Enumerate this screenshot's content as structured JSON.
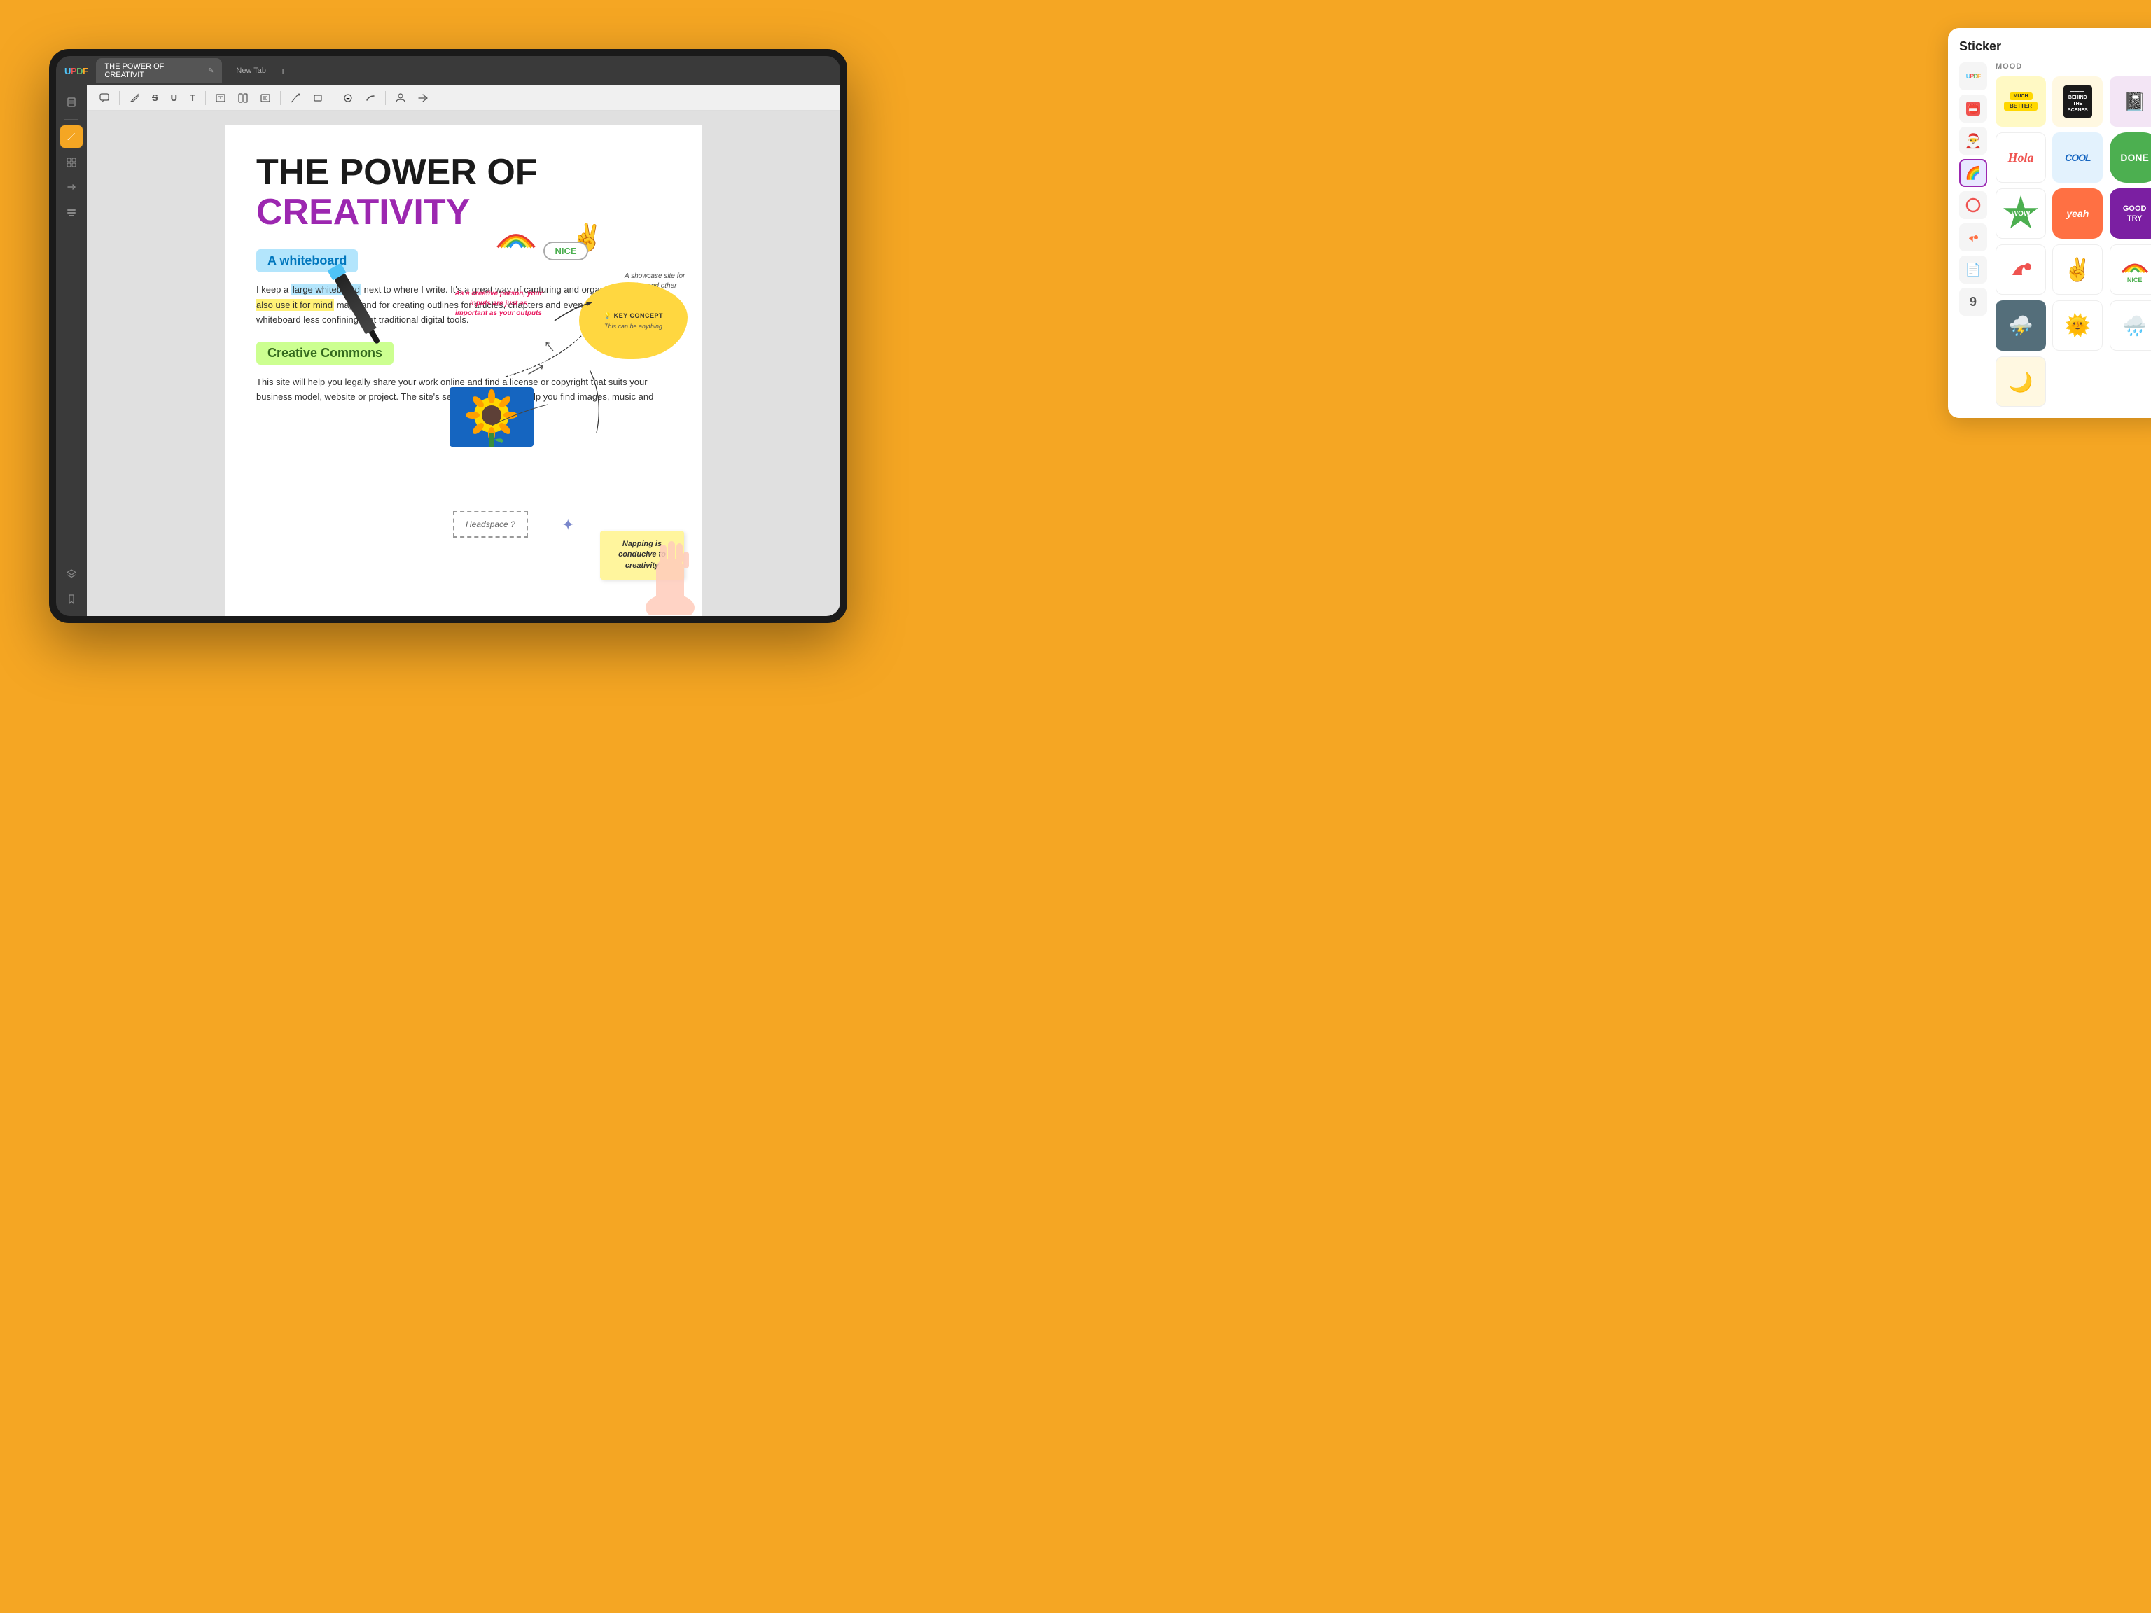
{
  "app": {
    "name": "UPDF",
    "logo_letters": [
      "U",
      "P",
      "D",
      "F"
    ]
  },
  "browser": {
    "tab_active": "THE POWER OF CREATIVIT",
    "tab_new": "New Tab",
    "tab_plus": "+"
  },
  "toolbar": {
    "tools": [
      "comment",
      "pencil",
      "strikethrough",
      "underline",
      "text",
      "text-box",
      "text-columns",
      "text-expand",
      "pen",
      "rectangle",
      "shape",
      "markup",
      "person",
      "more"
    ]
  },
  "sidebar": {
    "items": [
      {
        "icon": "📄",
        "name": "pages",
        "active": false
      },
      {
        "icon": "🖊",
        "name": "annotate",
        "active": true
      },
      {
        "icon": "📋",
        "name": "organize",
        "active": false
      },
      {
        "icon": "🔄",
        "name": "convert",
        "active": false
      },
      {
        "icon": "📦",
        "name": "compress",
        "active": false
      },
      {
        "icon": "🔖",
        "name": "bookmark",
        "active": false
      },
      {
        "icon": "📚",
        "name": "layers",
        "active": false
      }
    ]
  },
  "pdf": {
    "title_line1": "THE POWER OF",
    "title_line2": "CREATIVITY",
    "section1_label": "A whiteboard",
    "section1_body_1": "I keep a large whiteboard next to where I write. It's a great way of capturing and organising ideas. I also use it for mind maps and for creating outlines for articles, chapters and even books. I find a whiteboard less confining that traditional digital tools.",
    "section2_label": "Creative Commons",
    "section2_body": "This site will help you legally share your work online and find a license or copyright that suits your business model, website or project. The site's search tool will also help you find images, music and",
    "mindmap": {
      "key_concept_title": "KEY CONCEPT",
      "key_concept_sub": "This can be anything",
      "napping_note": "Napping is conducive to creativity",
      "headspace": "Headspace ?",
      "nice_badge": "NICE",
      "creative_quote": "As a creative person, your inputs are just as important as your outputs",
      "showcase_text": "A showcase site for design and other creative work."
    }
  },
  "sticker_panel": {
    "title": "Sticker",
    "category_label": "MOOD",
    "categories": [
      {
        "icon": "🏷",
        "name": "updf-logo-cat"
      },
      {
        "icon": "📛",
        "name": "sticker-cat-1"
      },
      {
        "icon": "🎅",
        "name": "sticker-cat-2"
      },
      {
        "icon": "🌈",
        "name": "sticker-cat-3",
        "active": true
      },
      {
        "icon": "⭕",
        "name": "sticker-cat-4"
      },
      {
        "icon": "↪",
        "name": "sticker-cat-5"
      },
      {
        "icon": "📄",
        "name": "sticker-cat-6"
      },
      {
        "icon": "9",
        "name": "sticker-cat-7"
      }
    ],
    "stickers": [
      {
        "id": "much-better",
        "label": "MUCH BETTER",
        "type": "text-yellow"
      },
      {
        "id": "behind-scenes",
        "label": "BEHIND THE SCENES",
        "type": "text-dark"
      },
      {
        "id": "notepad",
        "label": "📓",
        "type": "emoji"
      },
      {
        "id": "hola",
        "label": "Hola",
        "type": "text-red"
      },
      {
        "id": "cool",
        "label": "COOL",
        "type": "text-blue"
      },
      {
        "id": "done",
        "label": "DONE",
        "type": "text-green"
      },
      {
        "id": "wow",
        "label": "WOW",
        "type": "text-green-burst"
      },
      {
        "id": "yeah",
        "label": "yeah",
        "type": "text-orange"
      },
      {
        "id": "good-try",
        "label": "GOOD TRY",
        "type": "text-purple"
      },
      {
        "id": "arrow",
        "label": "↪",
        "type": "arrow-red"
      },
      {
        "id": "peace-hand",
        "label": "✌",
        "type": "hand-yellow"
      },
      {
        "id": "nice-rainbow",
        "label": "NICE",
        "type": "rainbow-text"
      },
      {
        "id": "thunder",
        "label": "⚡",
        "type": "thunder-cloud"
      },
      {
        "id": "sun-face",
        "label": "😊",
        "type": "sun-spiky"
      },
      {
        "id": "rain-cloud",
        "label": "🌧",
        "type": "rain-cloud"
      },
      {
        "id": "moon",
        "label": "🌙",
        "type": "moon-smile"
      }
    ]
  }
}
